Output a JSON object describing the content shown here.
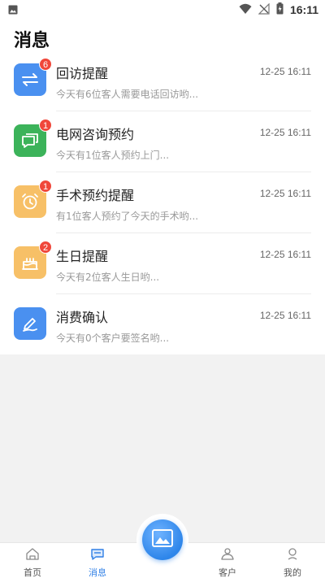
{
  "status_bar": {
    "time": "16:11",
    "icons": [
      "gallery-notification-icon",
      "wifi-icon",
      "no-signal-icon",
      "battery-charging-icon"
    ]
  },
  "page": {
    "title": "消息"
  },
  "colors": {
    "blue": "#4a90f0",
    "green": "#3cb35a",
    "orange": "#f7c067",
    "badge": "#f0473a",
    "accent": "#2f7fe6"
  },
  "messages": [
    {
      "title": "回访提醒",
      "time": "12-25 16:11",
      "preview": "今天有6位客人需要电话回访哟...",
      "badge": "6",
      "icon": "transfer-arrows-icon",
      "color": "#4a90f0"
    },
    {
      "title": "电网咨询预约",
      "time": "12-25 16:11",
      "preview": "今天有1位客人预约上门...",
      "badge": "1",
      "icon": "chat-monitor-icon",
      "color": "#3cb35a"
    },
    {
      "title": "手术预约提醒",
      "time": "12-25 16:11",
      "preview": "有1位客人预约了今天的手术哟...",
      "badge": "1",
      "icon": "alarm-clock-icon",
      "color": "#f7c067"
    },
    {
      "title": "生日提醒",
      "time": "12-25 16:11",
      "preview": "今天有2位客人生日哟...",
      "badge": "2",
      "icon": "birthday-cake-icon",
      "color": "#f7c067"
    },
    {
      "title": "消费确认",
      "time": "12-25 16:11",
      "preview": "今天有0个客户要签名哟...",
      "badge": "",
      "icon": "pen-sign-icon",
      "color": "#4a90f0"
    }
  ],
  "nav": {
    "home": "首页",
    "messages": "消息",
    "customers": "客户",
    "mine": "我的",
    "active": "messages"
  },
  "fab": {
    "icon": "image-icon"
  }
}
